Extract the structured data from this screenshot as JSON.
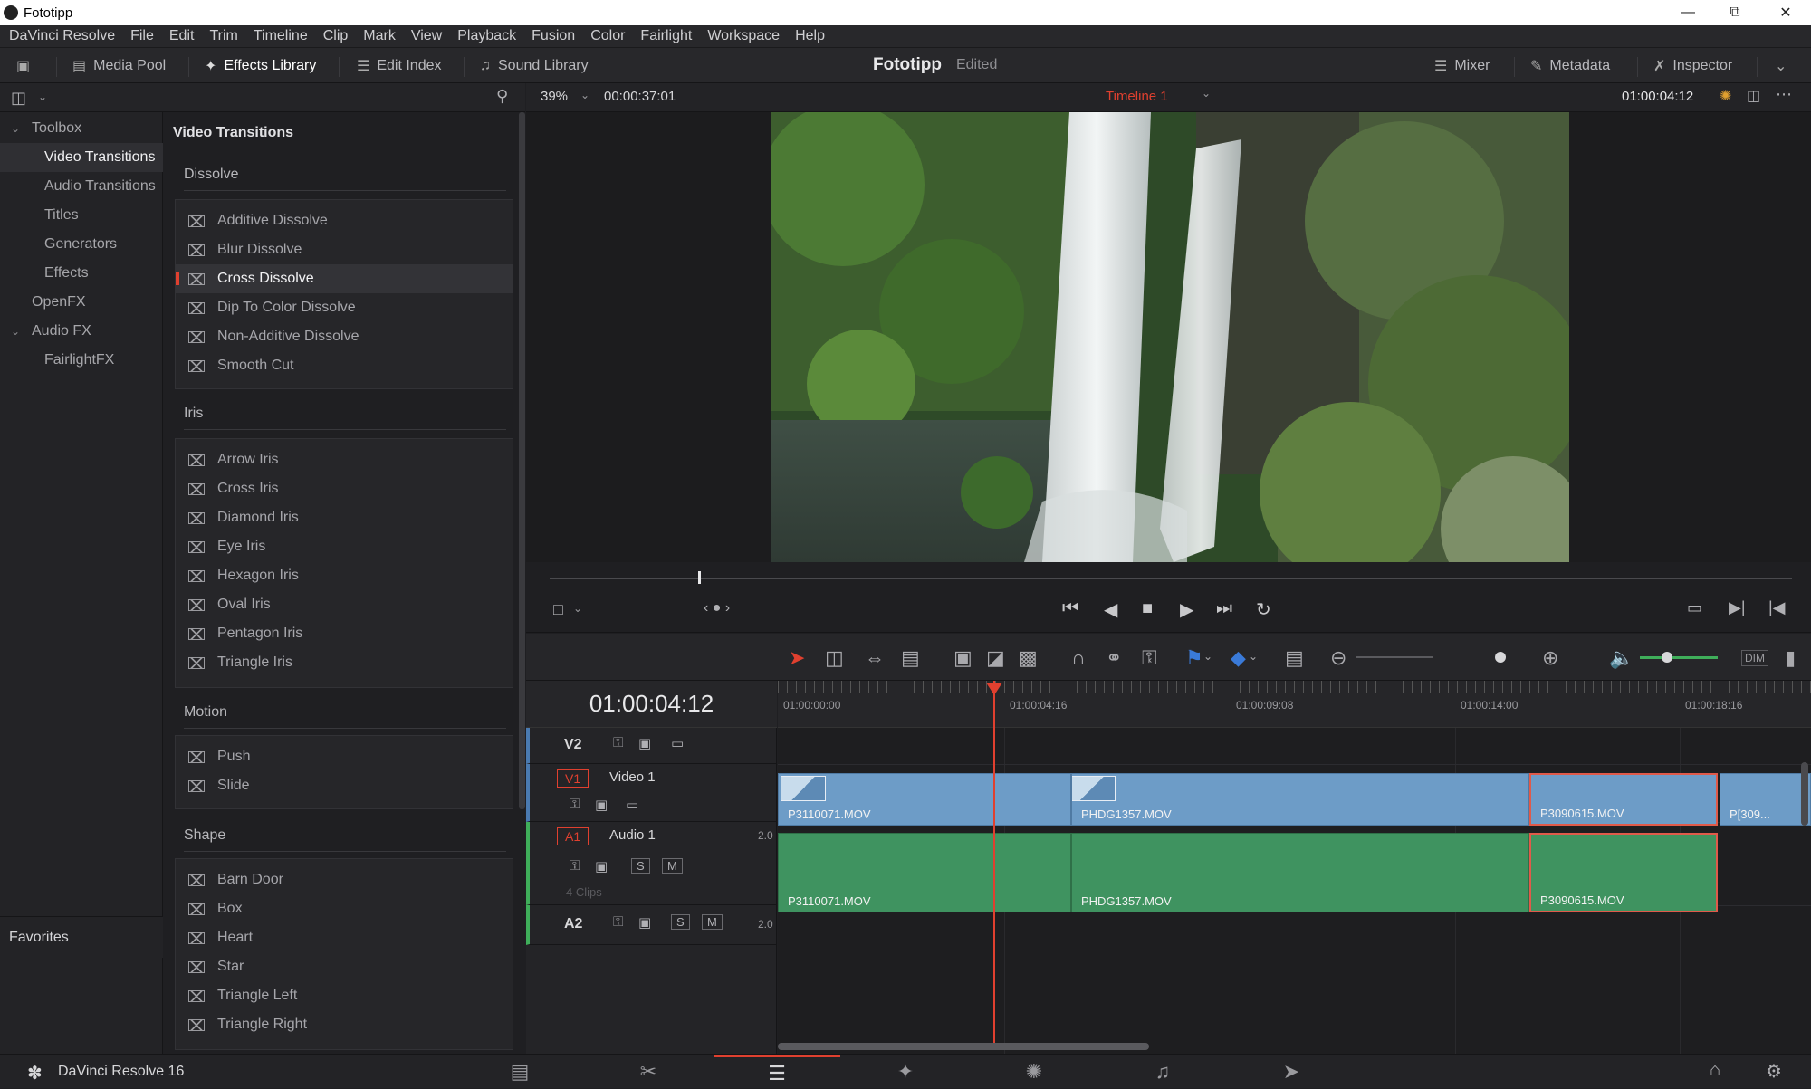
{
  "window": {
    "title": "Fototipp"
  },
  "menu": [
    "DaVinci Resolve",
    "File",
    "Edit",
    "Trim",
    "Timeline",
    "Clip",
    "Mark",
    "View",
    "Playback",
    "Fusion",
    "Color",
    "Fairlight",
    "Workspace",
    "Help"
  ],
  "toolbar": {
    "media_pool": "Media Pool",
    "effects_library": "Effects Library",
    "edit_index": "Edit Index",
    "sound_library": "Sound Library",
    "project_name": "Fototipp",
    "project_state": "Edited",
    "mixer": "Mixer",
    "metadata": "Metadata",
    "inspector": "Inspector"
  },
  "tree": {
    "toolbox": "Toolbox",
    "items": [
      "Video Transitions",
      "Audio Transitions",
      "Titles",
      "Generators",
      "Effects"
    ],
    "openfx": "OpenFX",
    "audiofx": "Audio FX",
    "fairlightfx": "FairlightFX",
    "favorites": "Favorites"
  },
  "effects": {
    "header": "Video Transitions",
    "groups": [
      {
        "name": "Dissolve",
        "items": [
          "Additive Dissolve",
          "Blur Dissolve",
          "Cross Dissolve",
          "Dip To Color Dissolve",
          "Non-Additive Dissolve",
          "Smooth Cut"
        ]
      },
      {
        "name": "Iris",
        "items": [
          "Arrow Iris",
          "Cross Iris",
          "Diamond Iris",
          "Eye Iris",
          "Hexagon Iris",
          "Oval Iris",
          "Pentagon Iris",
          "Triangle Iris"
        ]
      },
      {
        "name": "Motion",
        "items": [
          "Push",
          "Slide"
        ]
      },
      {
        "name": "Shape",
        "items": [
          "Barn Door",
          "Box",
          "Heart",
          "Star",
          "Triangle Left",
          "Triangle Right"
        ]
      }
    ]
  },
  "viewer": {
    "zoom": "39%",
    "duration": "00:00:37:01",
    "timeline_name": "Timeline 1",
    "timecode": "01:00:04:12"
  },
  "timeline": {
    "timecode": "01:00:04:12",
    "ruler": [
      "01:00:00:00",
      "01:00:04:16",
      "01:00:09:08",
      "01:00:14:00",
      "01:00:18:16"
    ],
    "tracks": {
      "v2": "V2",
      "v1": "V1",
      "v1_name": "Video 1",
      "a1": "A1",
      "a1_name": "Audio 1",
      "a1_channels": "2.0",
      "a1_clips": "4 Clips",
      "a2": "A2",
      "a2_channels": "2.0",
      "solo": "S",
      "mute": "M"
    },
    "video_clips": [
      "P3110071.MOV",
      "PHDG1357.MOV",
      "P3090615.MOV",
      "P[309..."
    ],
    "audio_clips": [
      "P3110071.MOV",
      "PHDG1357.MOV",
      "P3090615.MOV"
    ]
  },
  "bottom": {
    "app_name": "DaVinci Resolve 16"
  },
  "colors": {
    "accent": "#e0402f",
    "video_clip": "#6d9cc7",
    "audio_clip": "#3f9360"
  }
}
